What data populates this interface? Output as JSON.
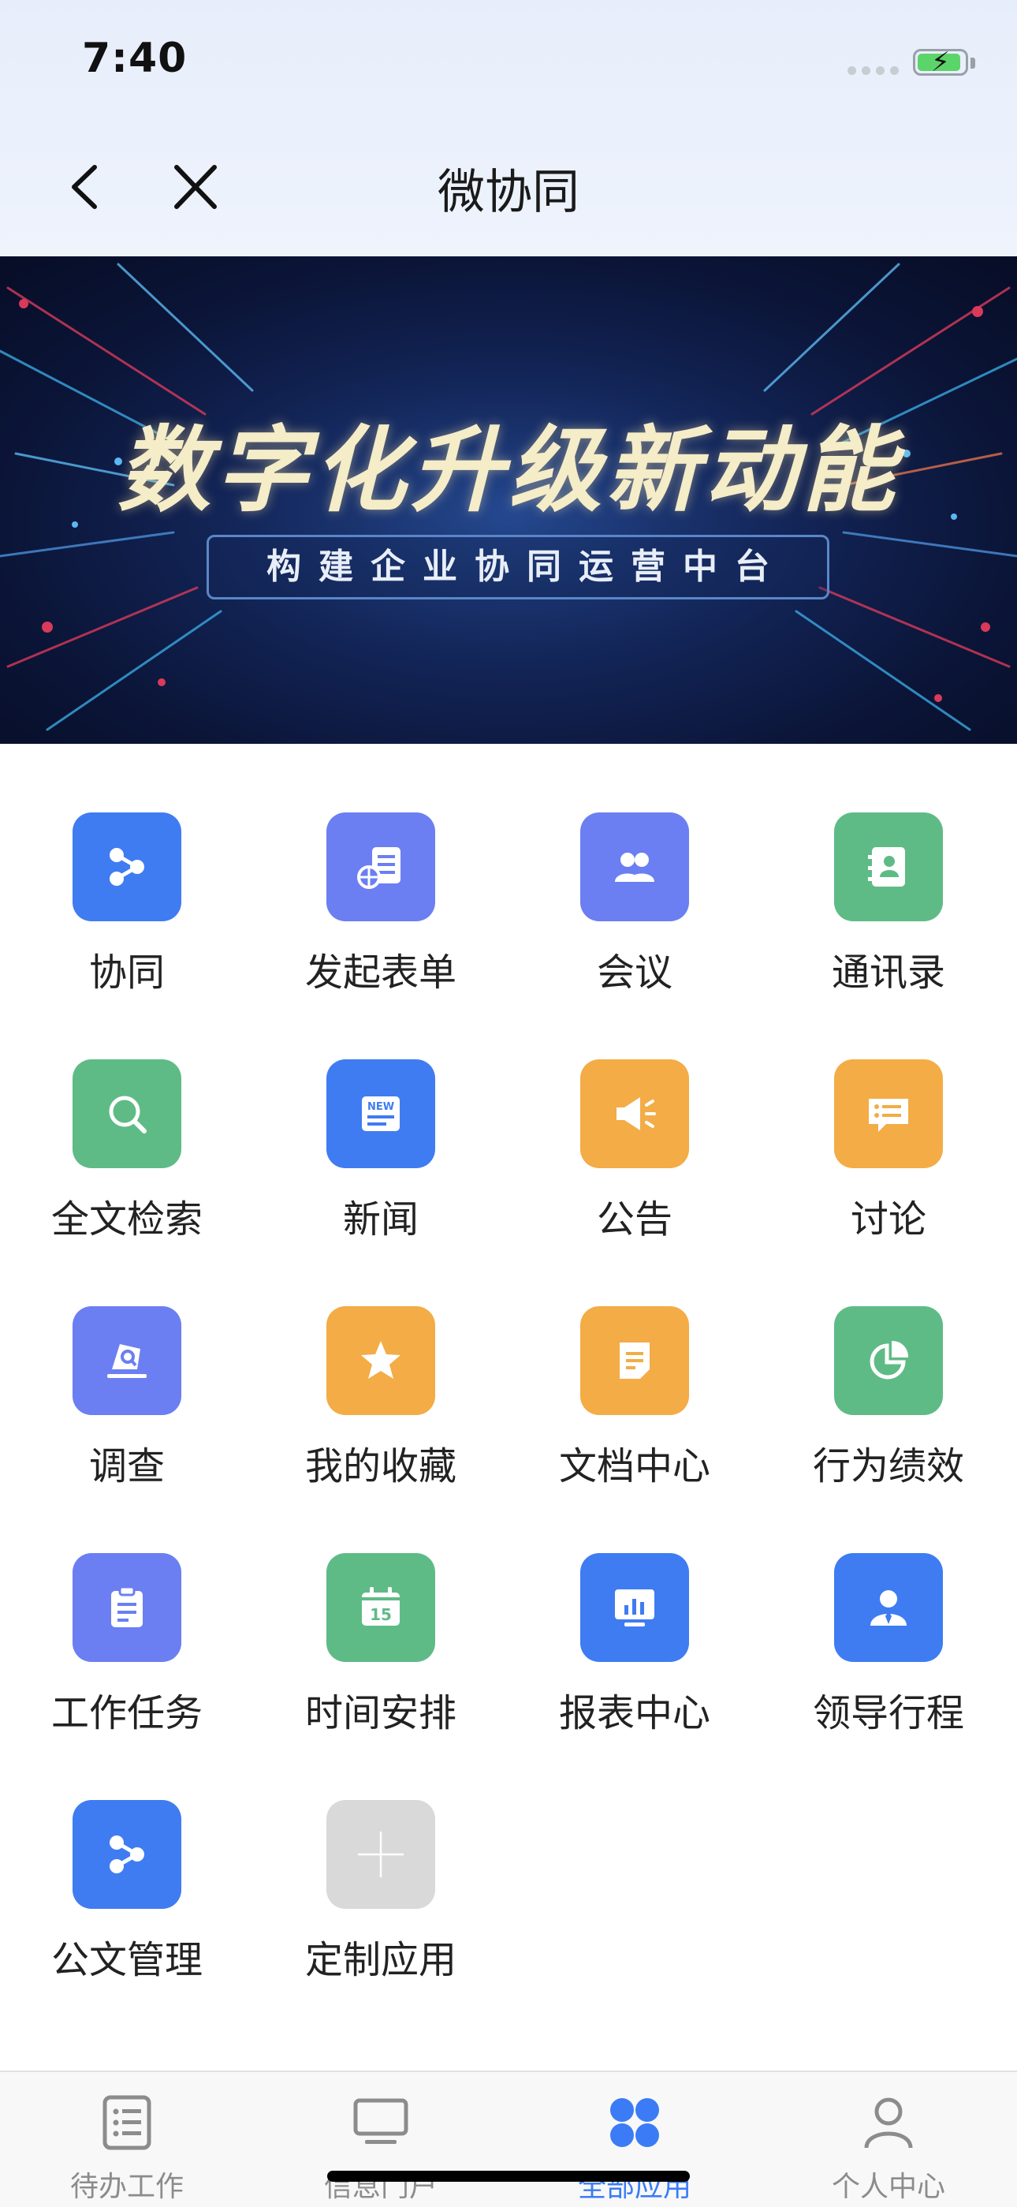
{
  "status_bar": {
    "time": "7:40"
  },
  "nav": {
    "title": "微协同"
  },
  "banner": {
    "headline": "数字化升级新动能",
    "subtitle": "构建企业协同运营中台"
  },
  "apps": [
    {
      "label": "协同",
      "icon": "share-nodes-icon",
      "color": "#3f7cf2"
    },
    {
      "label": "发起表单",
      "icon": "form-globe-icon",
      "color": "#6b7ff2"
    },
    {
      "label": "会议",
      "icon": "people-icon",
      "color": "#6b7ff2"
    },
    {
      "label": "通讯录",
      "icon": "contact-book-icon",
      "color": "#5fbb86"
    },
    {
      "label": "全文检索",
      "icon": "search-icon",
      "color": "#5fbb86"
    },
    {
      "label": "新闻",
      "icon": "news-icon",
      "color": "#3f7cf2"
    },
    {
      "label": "公告",
      "icon": "megaphone-icon",
      "color": "#f3ac46"
    },
    {
      "label": "讨论",
      "icon": "chat-bubble-icon",
      "color": "#f3ac46"
    },
    {
      "label": "调查",
      "icon": "survey-icon",
      "color": "#6b7ff2"
    },
    {
      "label": "我的收藏",
      "icon": "star-icon",
      "color": "#f3ac46"
    },
    {
      "label": "文档中心",
      "icon": "document-icon",
      "color": "#f3ac46"
    },
    {
      "label": "行为绩效",
      "icon": "pie-chart-icon",
      "color": "#5fbb86"
    },
    {
      "label": "工作任务",
      "icon": "clipboard-icon",
      "color": "#6b7ff2"
    },
    {
      "label": "时间安排",
      "icon": "calendar-icon",
      "color": "#5fbb86"
    },
    {
      "label": "报表中心",
      "icon": "report-board-icon",
      "color": "#3f7cf2"
    },
    {
      "label": "领导行程",
      "icon": "leader-icon",
      "color": "#3f7cf2"
    },
    {
      "label": "公文管理",
      "icon": "share-nodes-icon",
      "color": "#3f7cf2"
    },
    {
      "label": "定制应用",
      "icon": "plus-icon",
      "color": "#d9d9d9"
    }
  ],
  "tabbar": {
    "tabs": [
      {
        "label": "待办工作",
        "icon": "todo-list-icon",
        "active": false
      },
      {
        "label": "信息门户",
        "icon": "monitor-icon",
        "active": false
      },
      {
        "label": "全部应用",
        "icon": "apps-grid-icon",
        "active": true
      },
      {
        "label": "个人中心",
        "icon": "user-icon",
        "active": false
      }
    ]
  }
}
